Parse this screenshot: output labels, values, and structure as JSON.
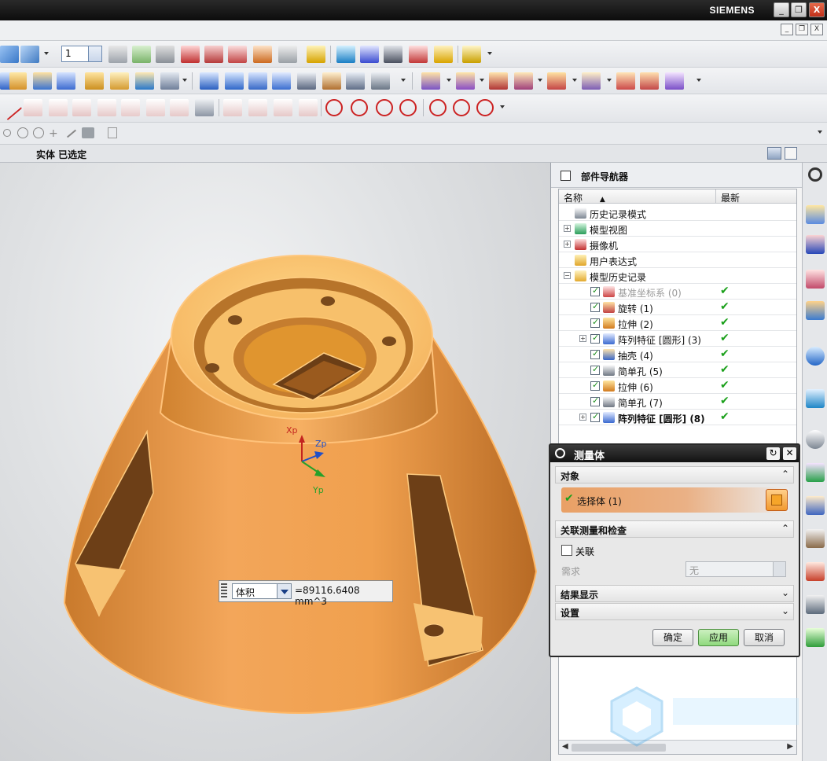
{
  "window": {
    "brand": "SIEMENS",
    "controls": {
      "minimize": "_",
      "maximize": "❐",
      "close": "X"
    }
  },
  "menubar": {
    "mdi_controls": [
      "_",
      "❐",
      "X"
    ]
  },
  "toolbar_row1": {
    "layer_value": "1"
  },
  "status": {
    "text": "实体 已选定"
  },
  "viewport": {
    "axes": {
      "x": "Xp",
      "z": "Zp",
      "y": "Yp"
    },
    "volume_widget": {
      "measure_type": "体积",
      "value": "=89116.6408 mm^3"
    },
    "model_color": "#f0a65a"
  },
  "part_navigator": {
    "title": "部件导航器",
    "columns": {
      "name": "名称",
      "latest": "最新"
    },
    "items": [
      {
        "label": "历史记录模式",
        "indent": 0,
        "expander": "",
        "checkbox": false,
        "icon": "clock-icon",
        "latest": ""
      },
      {
        "label": "模型视图",
        "indent": 0,
        "expander": "+",
        "checkbox": false,
        "icon": "model-view-icon",
        "latest": ""
      },
      {
        "label": "摄像机",
        "indent": 0,
        "expander": "+",
        "checkbox": false,
        "icon": "camera-icon",
        "latest": ""
      },
      {
        "label": "用户表达式",
        "indent": 0,
        "expander": "",
        "checkbox": false,
        "icon": "folder-icon",
        "latest": ""
      },
      {
        "label": "模型历史记录",
        "indent": 0,
        "expander": "−",
        "checkbox": false,
        "icon": "folder-open-icon",
        "latest": ""
      },
      {
        "label": "基准坐标系 (0)",
        "indent": 1,
        "expander": "",
        "checkbox": true,
        "icon": "datum-csys-icon",
        "latest": "✔",
        "style": "grey"
      },
      {
        "label": "旋转 (1)",
        "indent": 1,
        "expander": "",
        "checkbox": true,
        "icon": "revolve-icon",
        "latest": "✔"
      },
      {
        "label": "拉伸 (2)",
        "indent": 1,
        "expander": "",
        "checkbox": true,
        "icon": "extrude-icon",
        "latest": "✔"
      },
      {
        "label": "阵列特征 [圆形] (3)",
        "indent": 1,
        "expander": "+",
        "checkbox": true,
        "icon": "pattern-icon",
        "latest": "✔"
      },
      {
        "label": "抽壳 (4)",
        "indent": 1,
        "expander": "",
        "checkbox": true,
        "icon": "shell-icon",
        "latest": "✔"
      },
      {
        "label": "简单孔 (5)",
        "indent": 1,
        "expander": "",
        "checkbox": true,
        "icon": "hole-icon",
        "latest": "✔"
      },
      {
        "label": "拉伸 (6)",
        "indent": 1,
        "expander": "",
        "checkbox": true,
        "icon": "extrude-icon",
        "latest": "✔"
      },
      {
        "label": "简单孔 (7)",
        "indent": 1,
        "expander": "",
        "checkbox": true,
        "icon": "hole-icon",
        "latest": "✔"
      },
      {
        "label": "阵列特征 [圆形] (8)",
        "indent": 1,
        "expander": "+",
        "checkbox": true,
        "icon": "pattern-icon",
        "latest": "✔",
        "style": "bold"
      }
    ]
  },
  "dialog": {
    "title": "测量体",
    "sections": {
      "object": "对象",
      "select_body": "选择体 (1)",
      "assoc": "关联测量和检查",
      "assoc_checkbox": "关联",
      "requirement_label": "需求",
      "requirement_value": "无",
      "results": "结果显示",
      "settings": "设置"
    },
    "buttons": {
      "ok": "确定",
      "apply": "应用",
      "cancel": "取消"
    }
  }
}
